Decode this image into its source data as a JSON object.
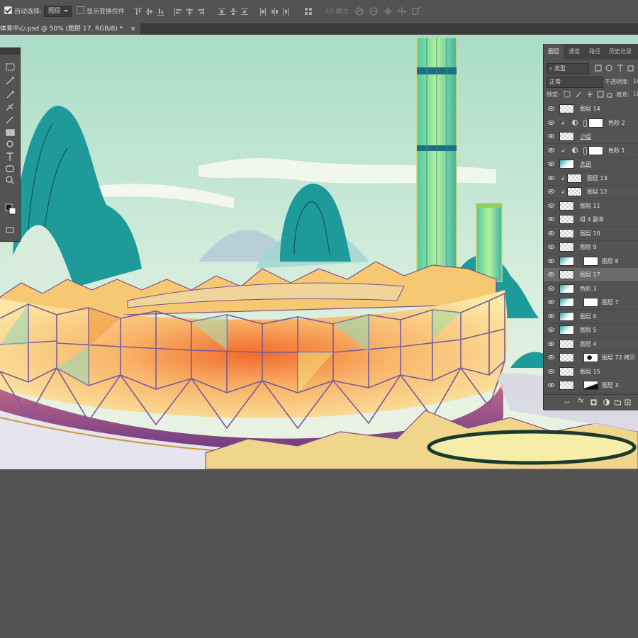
{
  "options_bar": {
    "auto_select_label": "自动选择:",
    "auto_select_value": "图层",
    "show_transform_label": "显示变换控件",
    "mode_3d_label": "3D 模式:"
  },
  "document_tab": {
    "title": "体育中心.psd @ 50% (图层 17, RGB/8) *",
    "close": "×"
  },
  "layers_panel": {
    "tabs": [
      "图层",
      "通道",
      "路径",
      "历史记录"
    ],
    "filter_kind": "类型",
    "blend_mode": "正常",
    "opacity_label": "不透明度:",
    "opacity_value": "10",
    "lock_label": "锁定:",
    "fill_label": "填充:",
    "fill_value": "10",
    "layers": [
      {
        "name": "图层 14"
      },
      {
        "name": "色阶 2"
      },
      {
        "name": "小运"
      },
      {
        "name": "色阶 1"
      },
      {
        "name": "大运"
      },
      {
        "name": "图层 13"
      },
      {
        "name": "图层 12"
      },
      {
        "name": "图层 11"
      },
      {
        "name": "组 4 副本"
      },
      {
        "name": "图层 10"
      },
      {
        "name": "图层 9"
      },
      {
        "name": "图层 8"
      },
      {
        "name": "图层 17"
      },
      {
        "name": "色阶 3"
      },
      {
        "name": "图层 7"
      },
      {
        "name": "图层 6"
      },
      {
        "name": "图层 5"
      },
      {
        "name": "图层 4"
      },
      {
        "name": "图层 72 拷贝"
      },
      {
        "name": "图层 15"
      },
      {
        "name": "图层 3"
      }
    ],
    "footer_fx": "fx"
  },
  "colors": {
    "ui_bg": "#535353",
    "sky": "#bfe3d0",
    "teal_mountain": "#1f9a9a",
    "selected_layer": "#6a6a6a"
  }
}
